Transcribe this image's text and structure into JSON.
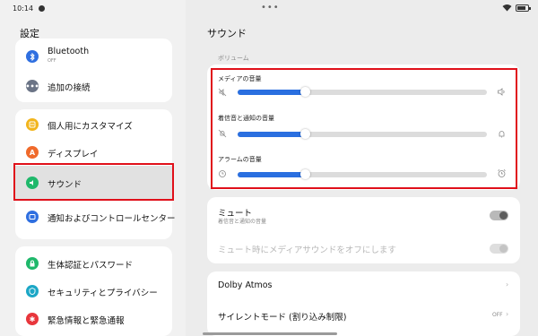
{
  "status_bar": {
    "time": "10:14",
    "center_glyph": "•••"
  },
  "left_panel": {
    "title": "設定",
    "items": [
      {
        "label": "Bluetooth",
        "sub": "OFF",
        "icon": "bluetooth-icon",
        "icon_color": "#2f6fe0"
      },
      {
        "label": "追加の接続",
        "icon": "more-icon",
        "icon_color": "#6b7486"
      },
      {
        "label": "個人用にカスタマイズ",
        "icon": "palette-icon",
        "icon_color": "#f2b51d"
      },
      {
        "label": "ディスプレイ",
        "icon": "display-icon",
        "icon_color": "#f06a2b"
      },
      {
        "label": "サウンド",
        "icon": "sound-icon",
        "icon_color": "#1fb86b"
      },
      {
        "label": "通知およびコントロールセンター",
        "icon": "notification-icon",
        "icon_color": "#2f6fe0"
      },
      {
        "label": "生体認証とパスワード",
        "icon": "lock-icon",
        "icon_color": "#1fb86b"
      },
      {
        "label": "セキュリティとプライバシー",
        "icon": "shield-icon",
        "icon_color": "#1ca7c6"
      },
      {
        "label": "緊急情報と緊急通報",
        "icon": "emergency-icon",
        "icon_color": "#e8363c"
      }
    ]
  },
  "right_panel": {
    "title": "サウンド",
    "volume_section_label": "ボリューム",
    "sliders": [
      {
        "label": "メディアの音量",
        "level": 0.27,
        "left_icon": "media-mute-icon",
        "right_icon": "speaker-icon"
      },
      {
        "label": "着信音と通知の音量",
        "level": 0.27,
        "left_icon": "bell-off-icon",
        "right_icon": "bell-icon"
      },
      {
        "label": "アラームの音量",
        "level": 0.27,
        "left_icon": "clock-icon",
        "right_icon": "alarm-clock-icon"
      }
    ],
    "mute": {
      "title": "ミュート",
      "sub": "着信音と通知の音量",
      "on": false
    },
    "mute_media": {
      "title": "ミュート時にメディアサウンドをオフにします",
      "enabled": false
    },
    "dolby": {
      "title": "Dolby Atmos"
    },
    "silent": {
      "title": "サイレントモード (割り込み制限)",
      "value": "OFF"
    }
  },
  "colors": {
    "accent": "#2a6fe0",
    "highlight_border": "#e0101a"
  }
}
